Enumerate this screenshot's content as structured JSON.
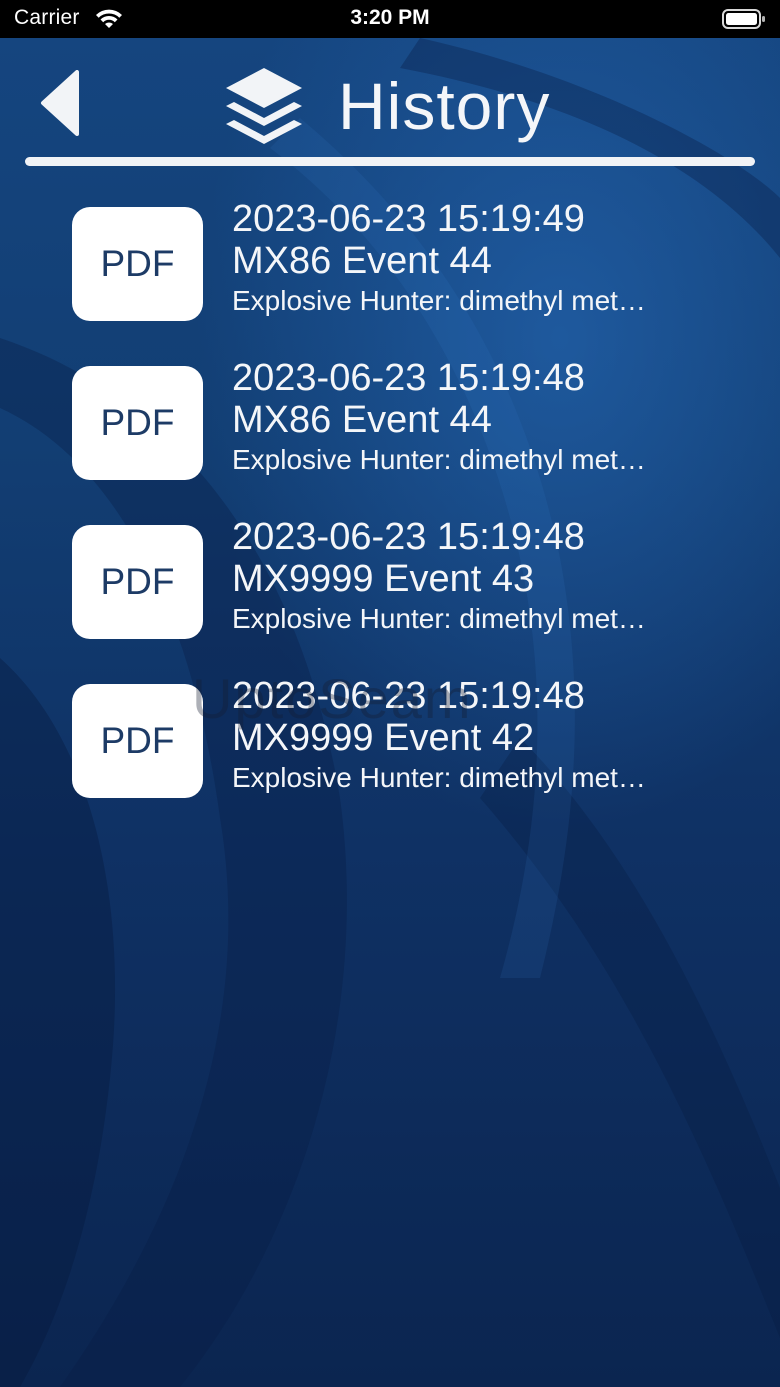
{
  "status_bar": {
    "carrier": "Carrier",
    "time": "3:20 PM"
  },
  "header": {
    "title": "History",
    "icon": "layers-icon",
    "back_icon": "chevron-left-icon"
  },
  "history": [
    {
      "badge": "PDF",
      "date": "2023-06-23 15:19:49",
      "name": "MX86 Event 44",
      "description": "Explosive Hunter: dimethyl met…"
    },
    {
      "badge": "PDF",
      "date": "2023-06-23 15:19:48",
      "name": "MX86 Event 44",
      "description": "Explosive Hunter: dimethyl met…"
    },
    {
      "badge": "PDF",
      "date": "2023-06-23 15:19:48",
      "name": "MX9999 Event 43",
      "description": "Explosive Hunter: dimethyl met…"
    },
    {
      "badge": "PDF",
      "date": "2023-06-23 15:19:48",
      "name": "MX9999 Event 42",
      "description": "Explosive Hunter: dimethyl met…"
    }
  ],
  "watermark": "UptoSeam"
}
